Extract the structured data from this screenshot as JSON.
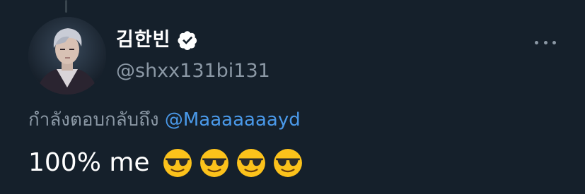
{
  "tweet": {
    "display_name": "김한빈",
    "handle": "@shxx131bi131",
    "reply_prefix": "กำลังตอบกลับถึง",
    "reply_mention": "@Maaaaaaayd",
    "text": "100% me",
    "emoji_count": 4,
    "emoji_name": "smiling-face-with-sunglasses"
  },
  "colors": {
    "background": "#15202b",
    "secondary_text": "#8b98a5",
    "link": "#4a99e9"
  },
  "icons": [
    "verified-badge-icon",
    "more-options-icon",
    "sunglasses-emoji-icon"
  ]
}
